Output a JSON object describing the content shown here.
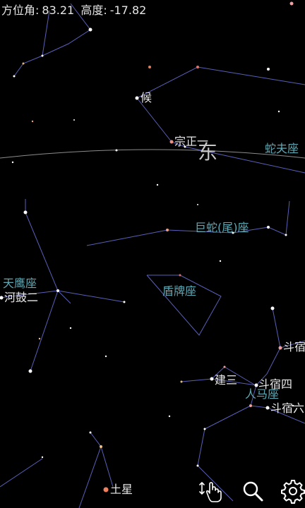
{
  "status": {
    "azimuth_label": "方位角:",
    "azimuth_value": "83.21",
    "altitude_label": "高度:",
    "altitude_value": "-17.82"
  },
  "direction_label": "东",
  "constellations": {
    "ophiuchus": "蛇夫座",
    "serpens_cauda": "巨蛇(尾)座",
    "scutum": "盾牌座",
    "aquila": "天鹰座",
    "sagittarius": "人马座"
  },
  "stars": {
    "hou": "候",
    "zongzheng": "宗正一",
    "hegu2": "河鼓二",
    "jiansan": "建三",
    "dousu4": "斗宿四",
    "dousu6": "斗宿六",
    "dousu": "斗宿",
    "saturn": "土星"
  },
  "toolbar": {
    "scroll_icon": "hand-swipe-icon",
    "search_icon": "magnifier-icon",
    "settings_icon": "gear-icon"
  },
  "colors": {
    "background": "#000000",
    "constellation_line": "#5a5fb8",
    "constellation_label": "#5fa8b4",
    "star_label": "#e8e8e8",
    "horizon": "#8c8c8c"
  }
}
